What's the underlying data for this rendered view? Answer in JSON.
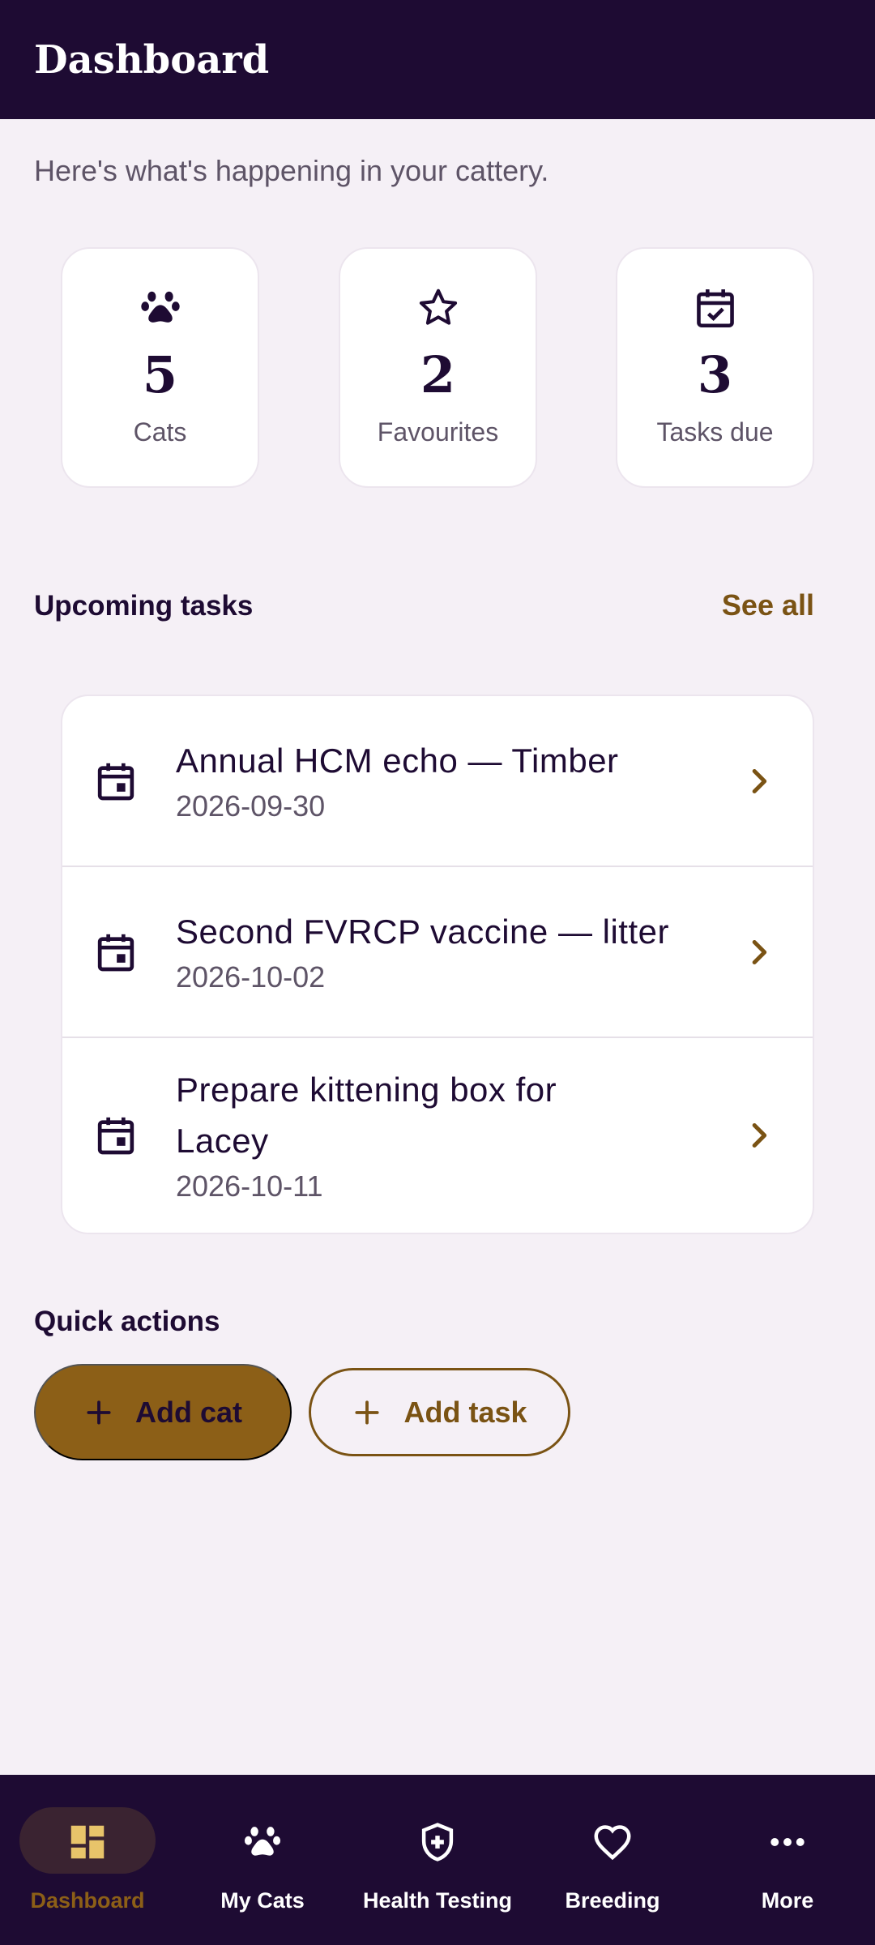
{
  "header": {
    "title": "Dashboard"
  },
  "subtitle": "Here's what's happening in your cattery.",
  "stats": [
    {
      "icon": "paw-icon",
      "value": "5",
      "label": "Cats"
    },
    {
      "icon": "star-icon",
      "value": "2",
      "label": "Favourites"
    },
    {
      "icon": "calendar-check-icon",
      "value": "3",
      "label": "Tasks due"
    }
  ],
  "upcoming": {
    "title": "Upcoming tasks",
    "see_all": "See all",
    "tasks": [
      {
        "title": "Annual HCM echo — Timber",
        "date": "2026-09-30"
      },
      {
        "title": "Second FVRCP vaccine — litter",
        "date": "2026-10-02"
      },
      {
        "title": "Prepare kittening box for Lacey",
        "date": "2026-10-11"
      }
    ]
  },
  "quick_actions": {
    "title": "Quick actions",
    "add_cat": "Add cat",
    "add_task": "Add task"
  },
  "nav": {
    "active": "Dashboard",
    "items": [
      {
        "icon": "dashboard-icon",
        "label": "Dashboard"
      },
      {
        "icon": "paw-icon",
        "label": "My Cats"
      },
      {
        "icon": "shield-cross-icon",
        "label": "Health Testing"
      },
      {
        "icon": "heart-icon",
        "label": "Breeding"
      },
      {
        "icon": "more-icon",
        "label": "More"
      }
    ]
  },
  "colors": {
    "header_bg": "#1e0b33",
    "background": "#f5f0f6",
    "accent": "#8c5f17",
    "accent_text": "#7a5314",
    "nav_icon_active": "#e8c46a"
  }
}
